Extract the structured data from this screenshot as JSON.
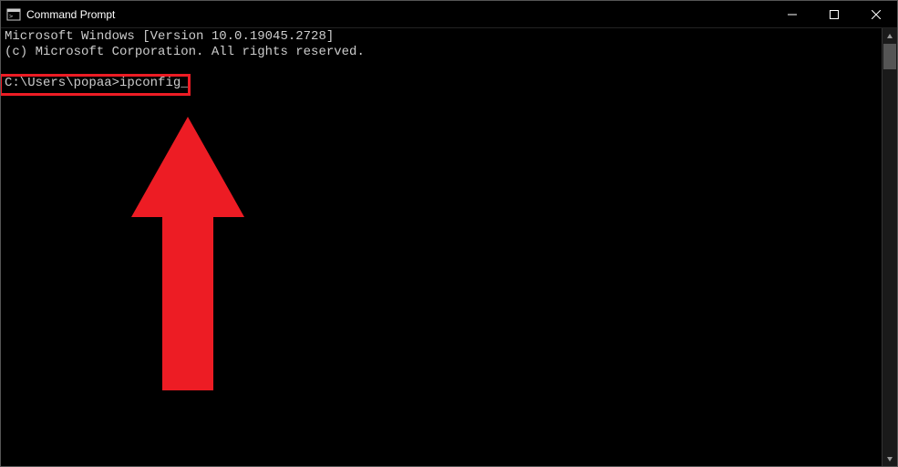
{
  "window": {
    "title": "Command Prompt"
  },
  "terminal": {
    "line1": "Microsoft Windows [Version 10.0.19045.2728]",
    "line2": "(c) Microsoft Corporation. All rights reserved.",
    "prompt": "C:\\Users\\popaa>",
    "command": "ipconfig"
  },
  "annotation": {
    "highlight_color": "#ed1c24",
    "arrow_color": "#ed1c24"
  }
}
